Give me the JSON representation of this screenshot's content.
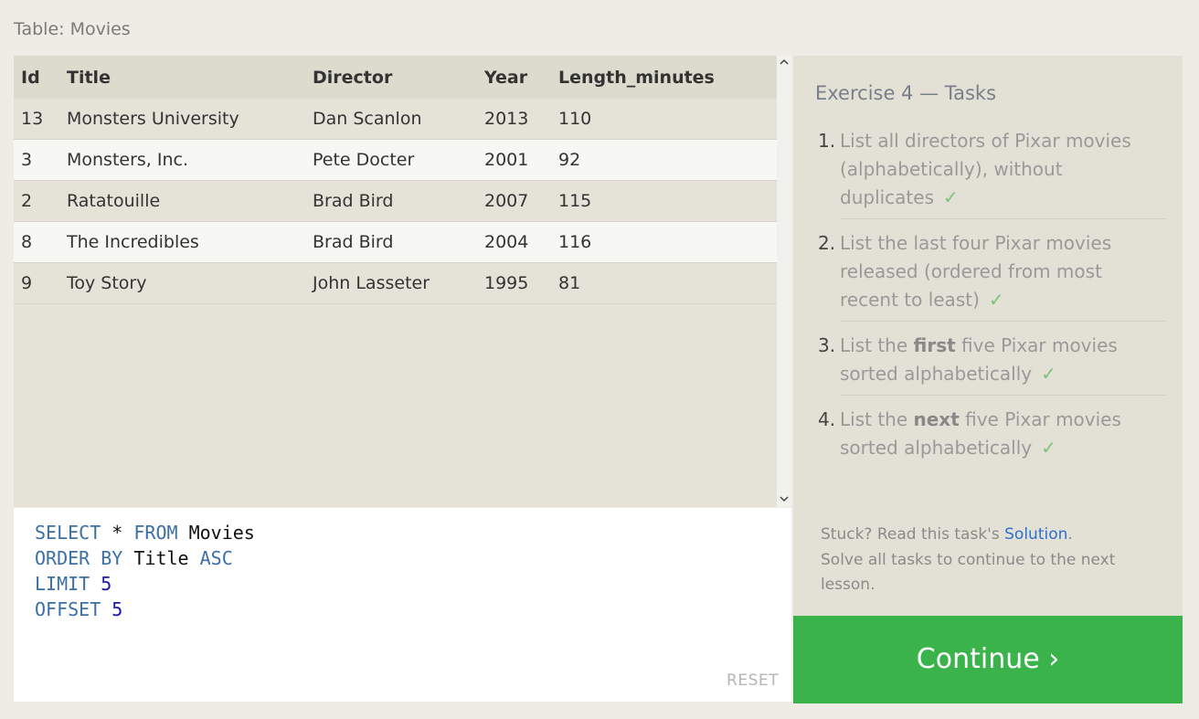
{
  "table": {
    "title": "Table: Movies",
    "columns": [
      "Id",
      "Title",
      "Director",
      "Year",
      "Length_minutes"
    ],
    "rows": [
      [
        "13",
        "Monsters University",
        "Dan Scanlon",
        "2013",
        "110"
      ],
      [
        "3",
        "Monsters, Inc.",
        "Pete Docter",
        "2001",
        "92"
      ],
      [
        "2",
        "Ratatouille",
        "Brad Bird",
        "2007",
        "115"
      ],
      [
        "8",
        "The Incredibles",
        "Brad Bird",
        "2004",
        "116"
      ],
      [
        "9",
        "Toy Story",
        "John Lasseter",
        "1995",
        "81"
      ]
    ]
  },
  "editor": {
    "lines": [
      [
        {
          "t": "kw",
          "v": "SELECT"
        },
        {
          "t": "ident",
          "v": " * "
        },
        {
          "t": "kw",
          "v": "FROM"
        },
        {
          "t": "ident",
          "v": " Movies"
        }
      ],
      [
        {
          "t": "kw",
          "v": "ORDER BY"
        },
        {
          "t": "ident",
          "v": " Title "
        },
        {
          "t": "kw",
          "v": "ASC"
        }
      ],
      [
        {
          "t": "kw",
          "v": "LIMIT"
        },
        {
          "t": "num",
          "v": " 5"
        }
      ],
      [
        {
          "t": "kw",
          "v": "OFFSET"
        },
        {
          "t": "num",
          "v": " 5"
        }
      ]
    ],
    "reset_label": "RESET"
  },
  "exercise": {
    "heading": "Exercise 4 — Tasks",
    "tasks": [
      {
        "num": "1.",
        "pre": "List all directors of Pixar movies (alphabetically), without duplicates",
        "bold": "",
        "post": "",
        "check": "✓"
      },
      {
        "num": "2.",
        "pre": "List the last four Pixar movies released (ordered from most recent to least)",
        "bold": "",
        "post": "",
        "check": "✓"
      },
      {
        "num": "3.",
        "pre": "List the ",
        "bold": "first",
        "post": " five Pixar movies sorted alphabetically",
        "check": "✓"
      },
      {
        "num": "4.",
        "pre": "List the ",
        "bold": "next",
        "post": " five Pixar movies sorted alphabetically",
        "check": "✓"
      }
    ],
    "help_prefix": "Stuck? Read this task's ",
    "solution_link": "Solution",
    "help_suffix": ".",
    "help_line2": "Solve all tasks to continue to the next lesson."
  },
  "continue_label": "Continue ›",
  "icons": {
    "scroll_up": "chevron-up-icon",
    "scroll_down": "chevron-down-icon",
    "check": "check-icon"
  }
}
